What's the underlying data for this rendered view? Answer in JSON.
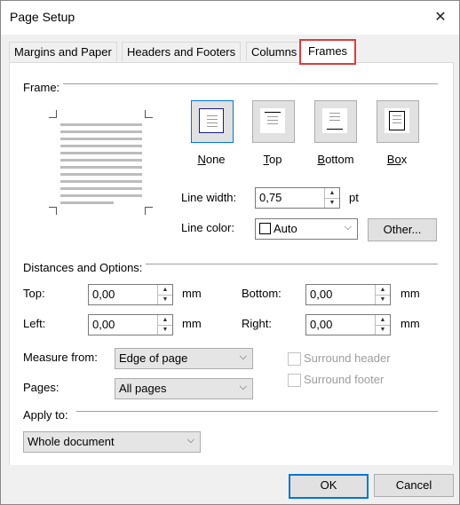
{
  "window": {
    "title": "Page Setup",
    "close_glyph": "✕"
  },
  "tabs": [
    {
      "label": "Margins and Paper"
    },
    {
      "label": "Headers and Footers"
    },
    {
      "label": "Columns"
    },
    {
      "label": "Frames"
    }
  ],
  "frame": {
    "group_title": "Frame:",
    "buttons": [
      {
        "label": "None",
        "underline": "N",
        "rest": "one"
      },
      {
        "label": "Top",
        "underline": "T",
        "rest": "op"
      },
      {
        "label": "Bottom",
        "underline": "B",
        "rest": "ottom"
      },
      {
        "label": "Box",
        "underline": "Bo",
        "rest": "x"
      }
    ],
    "line_width_label": "Line width:",
    "line_width_value": "0,75",
    "line_width_unit": "pt",
    "line_color_label": "Line color:",
    "line_color_value": "Auto",
    "other_button": "Other..."
  },
  "distances": {
    "group_title": "Distances and Options:",
    "top_label": "Top:",
    "top_value": "0,00",
    "bottom_label": "Bottom:",
    "bottom_value": "0,00",
    "left_label": "Left:",
    "left_value": "0,00",
    "right_label": "Right:",
    "right_value": "0,00",
    "unit": "mm",
    "measure_from_label": "Measure from:",
    "measure_from_value": "Edge of page",
    "pages_label": "Pages:",
    "pages_value": "All pages",
    "surround_header": "Surround header",
    "surround_footer": "Surround footer"
  },
  "apply": {
    "group_title": "Apply to:",
    "value": "Whole document"
  },
  "footer": {
    "ok": "OK",
    "cancel": "Cancel"
  },
  "colors": {
    "accent": "#0078d7",
    "highlight": "#e03b3b"
  }
}
